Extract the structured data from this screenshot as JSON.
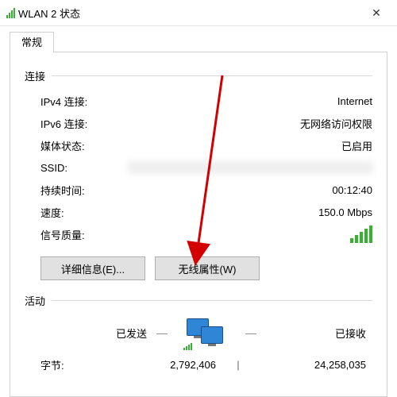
{
  "titlebar": {
    "title": "WLAN 2 状态"
  },
  "tab": {
    "general": "常规"
  },
  "group": {
    "connection": "连接",
    "activity": "活动"
  },
  "conn": {
    "ipv4_k": "IPv4 连接:",
    "ipv4_v": "Internet",
    "ipv6_k": "IPv6 连接:",
    "ipv6_v": "无网络访问权限",
    "media_k": "媒体状态:",
    "media_v": "已启用",
    "ssid_k": "SSID:",
    "ssid_v": "",
    "dur_k": "持续时间:",
    "dur_v": "00:12:40",
    "speed_k": "速度:",
    "speed_v": "150.0 Mbps",
    "signal_k": "信号质量:"
  },
  "btn": {
    "details": "详细信息(E)...",
    "wireless": "无线属性(W)"
  },
  "activity": {
    "sent": "已发送",
    "recv": "已接收",
    "bytes_k": "字节:",
    "bytes_sent": "2,792,406",
    "bytes_recv": "24,258,035",
    "dash": "—"
  }
}
